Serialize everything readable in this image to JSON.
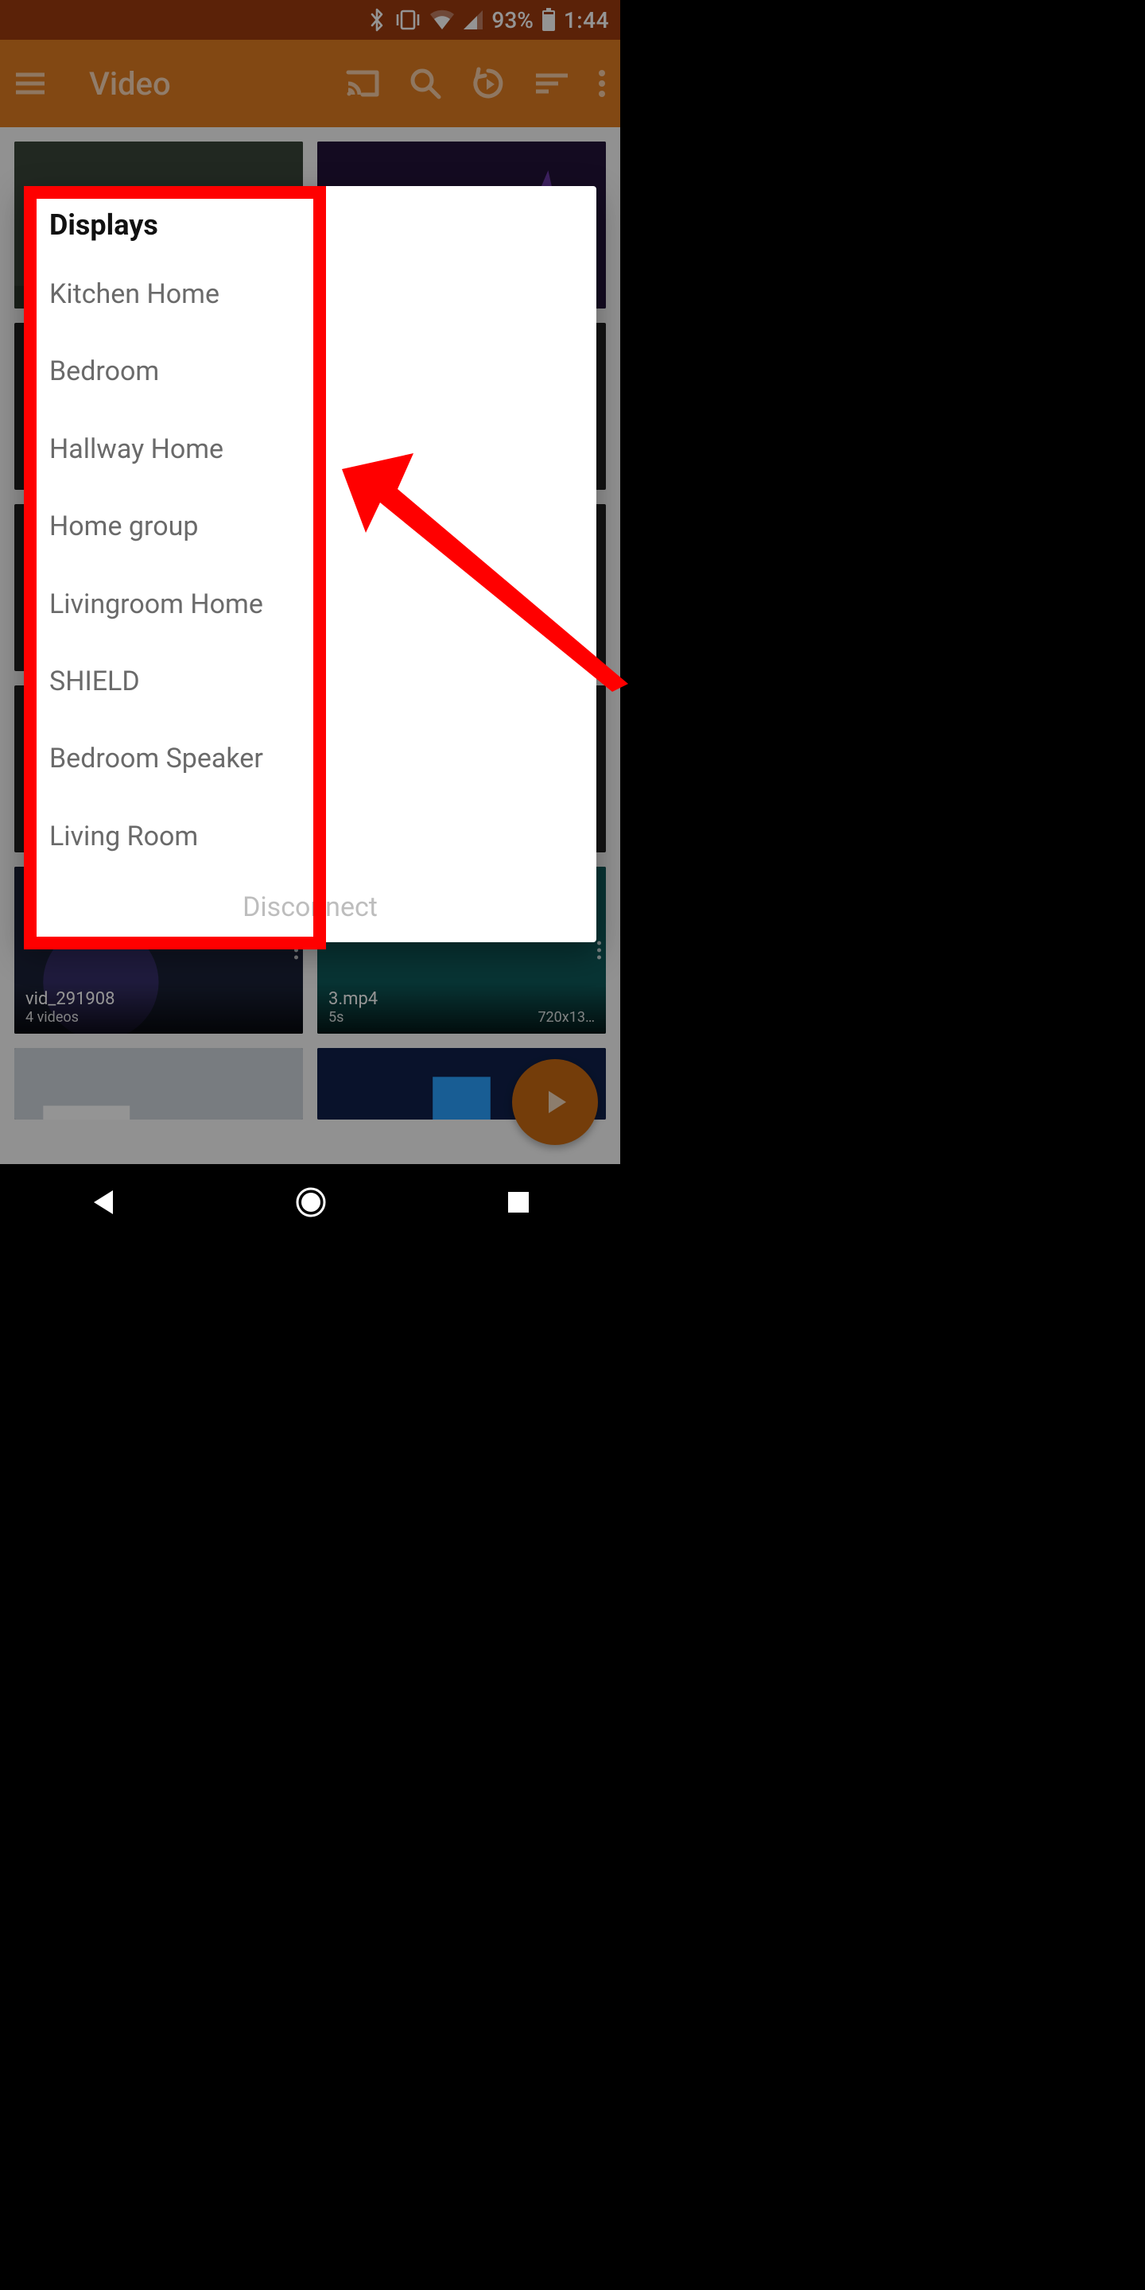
{
  "statusbar": {
    "battery_pct": "93%",
    "time": "1:44",
    "icons": [
      "bluetooth",
      "vibrate",
      "wifi",
      "cell",
      "battery"
    ]
  },
  "appbar": {
    "title": "Video",
    "actions": [
      "menu",
      "cast",
      "search",
      "history",
      "sort",
      "more"
    ]
  },
  "dialog": {
    "title": "Displays",
    "items": [
      "Kitchen Home",
      "Bedroom",
      "Hallway Home",
      "Home group",
      "Livingroom Home",
      "SHIELD",
      "Bedroom Speaker",
      "Living Room"
    ],
    "footer": "Disconnect"
  },
  "tiles": [
    {
      "title": "vid_291908",
      "sub_left": "4 videos",
      "sub_right": ""
    },
    {
      "title": "3.mp4",
      "sub_left": "5s",
      "sub_right": "720x13…"
    }
  ],
  "colors": {
    "status_bg": "#9e3b0e",
    "appbar_bg": "#e07c22",
    "accent": "#c96a12",
    "annotation": "#ff0000"
  }
}
